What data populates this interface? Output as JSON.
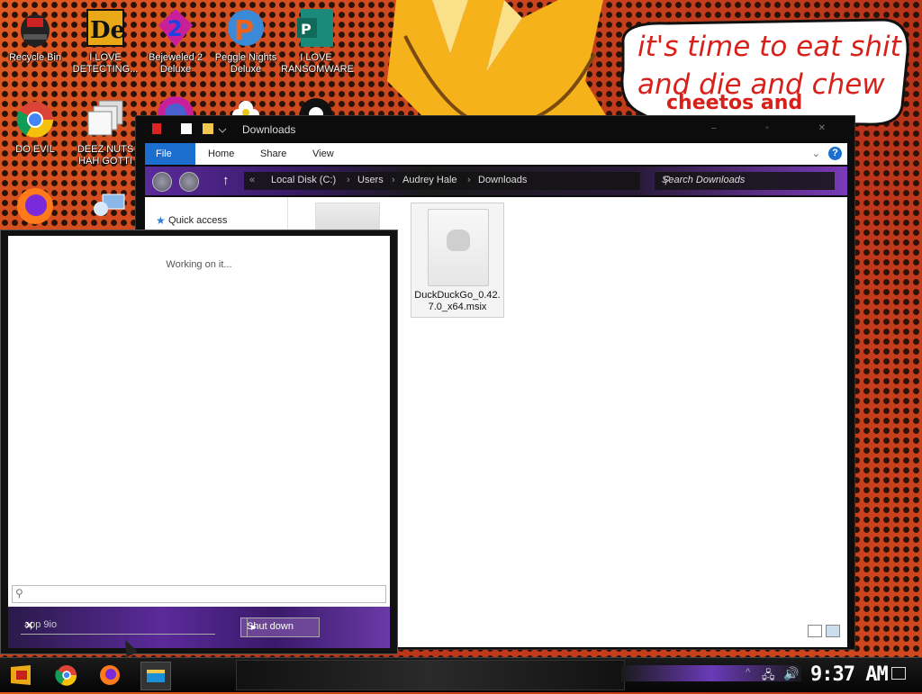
{
  "desktop": {
    "icons": [
      {
        "label": "Recycle Bin",
        "icon": "recycle-bin-icon"
      },
      {
        "label": "I LOVE DETECTING...",
        "icon": "de-app-icon"
      },
      {
        "label": "Bejeweled 2 Deluxe",
        "icon": "bejeweled-icon"
      },
      {
        "label": "Peggle Nights Deluxe",
        "icon": "peggle-icon"
      },
      {
        "label": "I LOVE RANSOMWARE",
        "icon": "publisher-icon"
      },
      {
        "label": "DO EVIL",
        "icon": "chrome-icon"
      },
      {
        "label": "DEEZ NUTS HAH GOTTI",
        "icon": "stacked-windows-icon"
      },
      {
        "label": "",
        "icon": "firefox-icon"
      },
      {
        "label": "",
        "icon": "network-icon"
      }
    ],
    "speech_bubble": {
      "line1": "it's time to eat shit",
      "line2": "and die and chew",
      "line3": "cheetos and"
    }
  },
  "explorer": {
    "title": "Downloads",
    "ribbon_tabs": [
      "File",
      "Home",
      "Share",
      "View"
    ],
    "breadcrumbs": [
      "Local Disk (C:)",
      "Users",
      "Audrey Hale",
      "Downloads"
    ],
    "search_placeholder": "Search Downloads",
    "nav_pane": {
      "quick_access": "Quick access"
    },
    "files": [
      {
        "name": "DuckDuckGo_0.42.7.0_x64.msix"
      }
    ]
  },
  "start_menu": {
    "status": "Working on it...",
    "user_field": "app 9io",
    "shutdown_label": "Shut down"
  },
  "taskbar": {
    "pinned": [
      "start-icon",
      "chrome-icon",
      "firefox-icon",
      "file-explorer-icon"
    ],
    "clock": "9:37 AM"
  },
  "colors": {
    "accent_blue": "#1c6fcf",
    "purple_theme": "#5a2a9a",
    "bubble_text": "#d8201a"
  }
}
